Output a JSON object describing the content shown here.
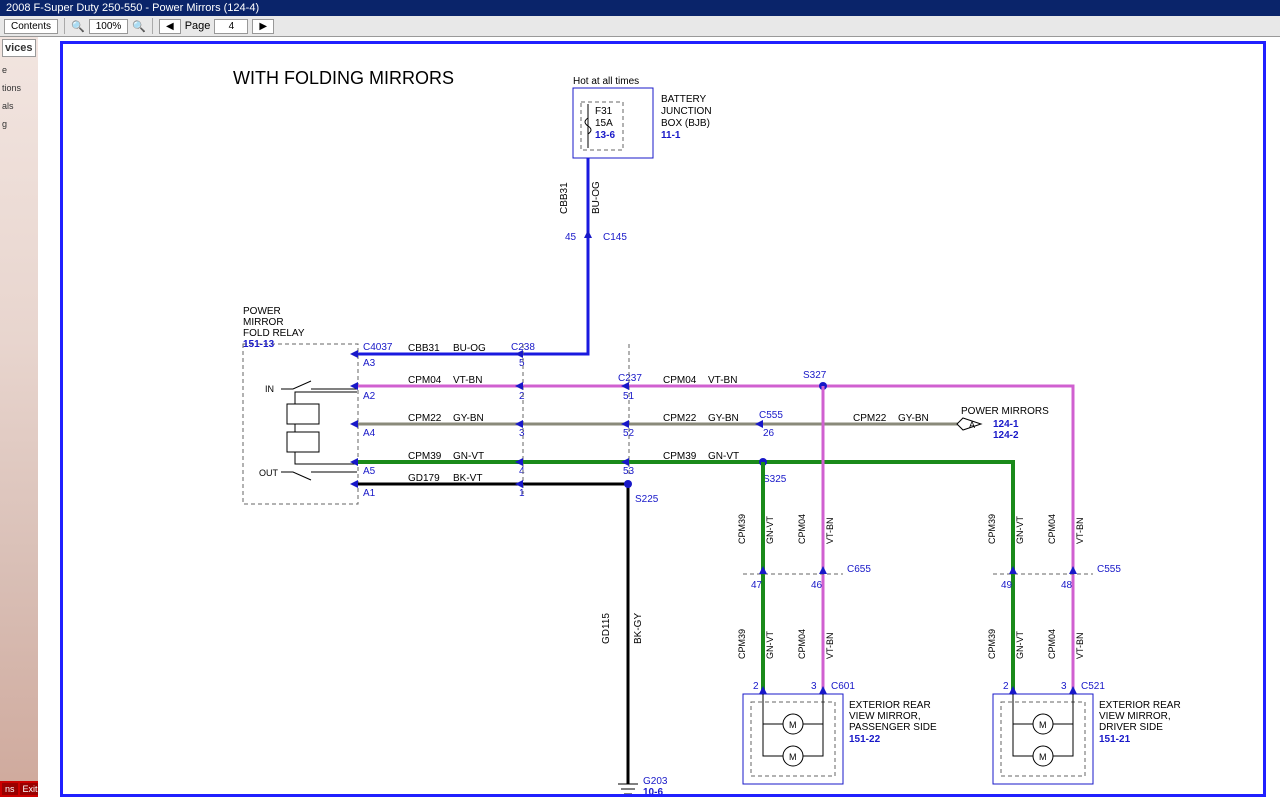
{
  "window": {
    "title": "2008 F-Super Duty 250-550 - Power Mirrors (124-4)"
  },
  "toolbar": {
    "contents": "Contents",
    "zoom": "100%",
    "page_prefix": "Page",
    "page_num": "4"
  },
  "sidebar": {
    "header": "vices",
    "items": [
      "e",
      "tions",
      "als",
      "g"
    ],
    "footer_left": "ns",
    "footer_right": "Exit"
  },
  "diagram": {
    "title": "WITH FOLDING MIRRORS",
    "bjb": {
      "hot": "Hot at all times",
      "fuse": "F31",
      "amps": "15A",
      "ref": "13-6",
      "name1": "BATTERY",
      "name2": "JUNCTION",
      "name3": "BOX (BJB)",
      "cell": "11-1"
    },
    "wires": {
      "cbb31": "CBB31",
      "buog": "BU-OG",
      "cpm04": "CPM04",
      "vtbn": "VT-BN",
      "cpm22": "CPM22",
      "gybn": "GY-BN",
      "cpm39": "CPM39",
      "gnvt": "GN-VT",
      "gd179": "GD179",
      "bkvt": "BK-VT",
      "gd115": "GD115",
      "bkgy": "BK-GY"
    },
    "connectors": {
      "c145": "C145",
      "c4037": "C4037",
      "c238": "C238",
      "c237": "C237",
      "c555": "C555",
      "c655": "C655",
      "c601": "C601",
      "c521": "C521",
      "s327": "S327",
      "s325": "S325",
      "s225": "S225",
      "g203": "G203",
      "g203ref": "10-6"
    },
    "pins": {
      "p45": "45",
      "a3": "A3",
      "a2": "A2",
      "a4": "A4",
      "a5": "A5",
      "a1": "A1",
      "p5": "5",
      "p2": "2",
      "p3": "3",
      "p4": "4",
      "p1": "1",
      "p51": "51",
      "p52": "52",
      "p53": "53",
      "p26": "26",
      "p47": "47",
      "p46": "46",
      "p49": "49",
      "p48": "48",
      "p2b": "2",
      "p3b": "3",
      "p2c": "2",
      "p3c": "3"
    },
    "relay": {
      "l1": "POWER",
      "l2": "MIRROR",
      "l3": "FOLD RELAY",
      "ref": "151-13",
      "in": "IN",
      "out": "OUT"
    },
    "pm_ref": {
      "name": "POWER MIRRORS",
      "a": "A",
      "r1": "124-1",
      "r2": "124-2"
    },
    "mirror_pass": {
      "l1": "EXTERIOR REAR",
      "l2": "VIEW MIRROR,",
      "l3": "PASSENGER SIDE",
      "ref": "151-22",
      "m": "M"
    },
    "mirror_drv": {
      "l1": "EXTERIOR REAR",
      "l2": "VIEW MIRROR,",
      "l3": "DRIVER SIDE",
      "ref": "151-21",
      "m": "M"
    }
  }
}
